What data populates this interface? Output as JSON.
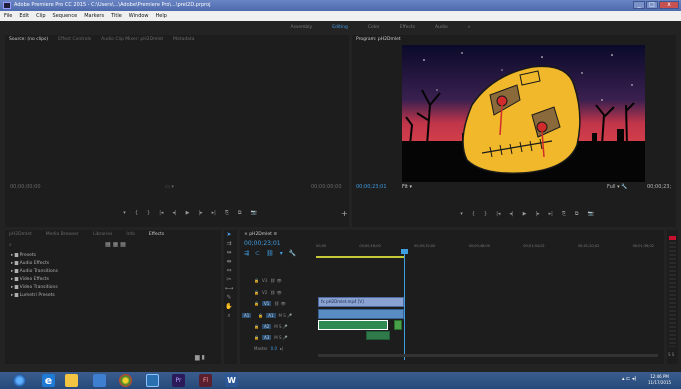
{
  "window": {
    "title": "Adobe Premiere Pro CC 2015 - C:\\Users\\...\\Adobe\\Premiere Pro\\...\\prel2D.prproj",
    "controls": [
      "_",
      "□",
      "x"
    ]
  },
  "menu": [
    "File",
    "Edit",
    "Clip",
    "Sequence",
    "Markers",
    "Title",
    "Window",
    "Help"
  ],
  "workspaces": [
    "Assembly",
    "Editing",
    "Color",
    "Effects",
    "Audio",
    "»"
  ],
  "source": {
    "tabs": [
      "Source: (no clips)",
      "Effect Controls",
      "Audio Clip Mixer: pH2Dmlet",
      "Metadata"
    ],
    "timecode_left": "00;00;00;00",
    "timecode_right": "00;00;00;00",
    "controls": [
      "▾",
      "{",
      "}",
      "|◂",
      "◂|",
      "▶",
      "|▸",
      "▸|",
      "⎘",
      "⧉",
      "📷",
      "+"
    ]
  },
  "program": {
    "tab": "Program: pH2Dmlet",
    "timecode": "00;00;23;01",
    "fit": "Fit",
    "full": "Full",
    "duration": "00;00;23;",
    "controls": [
      "▾",
      "{",
      "}",
      "|◂",
      "◂|",
      "▶",
      "|▸",
      "▸|",
      "⎘",
      "⧉",
      "📷"
    ]
  },
  "project": {
    "tabs": [
      "pH2Dmlet",
      "Media Browser",
      "Libraries",
      "Info",
      "Effects"
    ],
    "search_placeholder": "",
    "items": [
      "Presets",
      "Audio Effects",
      "Audio Transitions",
      "Video Effects",
      "Video Transitions",
      "Lumetri Presets"
    ]
  },
  "timeline": {
    "tab": "pH2Dmlet",
    "timecode": "00;00;23;01",
    "ruler": [
      "00;00",
      "00;00;16;00",
      "00;00;32;00",
      "00;00;48;00",
      "00;01;04;02",
      "00;01;20;02",
      "00;01;36;02"
    ],
    "tracks": [
      {
        "name": "V3",
        "icons": "⛓ 👁"
      },
      {
        "name": "V2",
        "icons": "⛓ 👁"
      },
      {
        "name": "V1",
        "icons": "⛓ 👁"
      },
      {
        "name": "A1",
        "icons": "M S 🎤"
      },
      {
        "name": "A2",
        "icons": "M S 🎤"
      },
      {
        "name": "A3",
        "icons": "M S 🎤"
      }
    ],
    "master": {
      "label": "Master",
      "value": "0.0"
    },
    "clips": {
      "video_label": "pH2Dmlet.mp4 [V]",
      "fx_label": "fx"
    }
  },
  "taskbar": {
    "clock_time": "12:46 PM",
    "clock_date": "11/17/2015"
  }
}
